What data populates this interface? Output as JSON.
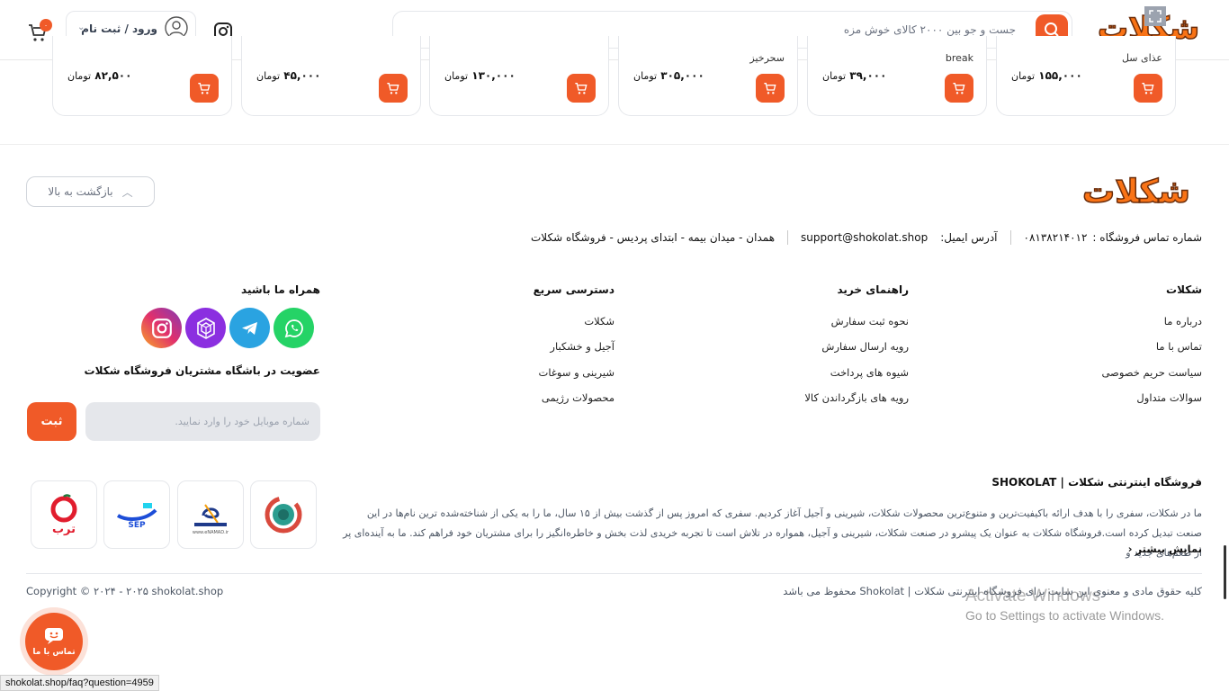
{
  "header": {
    "logo_text": "شکلات",
    "search_placeholder": "جست و جو بین ۲۰۰۰ کالای خوش مزه",
    "login_label": "ورود / ثبت نام",
    "cart_count": "۰"
  },
  "products": [
    {
      "name": "عذای سل",
      "price": "۱۵۵,۰۰۰",
      "unit": "تومان"
    },
    {
      "name": "break",
      "price": "۳۹,۰۰۰",
      "unit": "تومان"
    },
    {
      "name": "سحرخیز",
      "price": "۳۰۵,۰۰۰",
      "unit": "تومان"
    },
    {
      "name": "",
      "price": "۱۳۰,۰۰۰",
      "unit": "تومان"
    },
    {
      "name": "",
      "price": "۴۵,۰۰۰",
      "unit": "تومان"
    },
    {
      "name": "",
      "price": "۸۲,۵۰۰",
      "unit": "تومان"
    }
  ],
  "footer": {
    "logo_text": "شکلات",
    "back_to_top": "بازگشت به بالا",
    "contact": {
      "phone_label": "شماره تماس فروشگاه :",
      "phone": "۰۸۱۳۸۲۱۴۰۱۲",
      "email_label": "آدرس ایمیل:",
      "email": "support@shokolat.shop",
      "address": "همدان - میدان بیمه - ابتدای پردیس - فروشگاه شکلات"
    },
    "columns": [
      {
        "title": "شکلات",
        "links": [
          "درباره ما",
          "تماس با ما",
          "سیاست حریم خصوصی",
          "سوالات متداول"
        ]
      },
      {
        "title": "راهنمای خرید",
        "links": [
          "نحوه ثبت سفارش",
          "رویه ارسال سفارش",
          "شیوه های پرداخت",
          "رویه های بازگرداندن کالا"
        ]
      },
      {
        "title": "دسترسی سریع",
        "links": [
          "شکلات",
          "آجیل و خشکبار",
          "شیرینی و سوغات",
          "محصولات رژیمی"
        ]
      }
    ],
    "social_title": "همراه ما باشید",
    "club_title": "عضویت در باشگاه مشتریان فروشگاه شکلات",
    "mobile_placeholder": "شماره موبایل خود را وارد نمایید.",
    "submit_label": "ثبت",
    "about_title": "فروشگاه اینترنتی شکلات | SHOKOLAT",
    "about_text": "ما در شکلات، سفری را با هدف ارائه باکیفیت‌ترین و متنوع‌ترین محصولات شکلات، شیرینی و آجیل آغاز کردیم. سفری که امروز پس از گذشت بیش از ۱۵ سال، ما را به یکی از شناخته‌شده ترین نام‌ها در این صنعت تبدیل کرده است.فروشگاه شکلات به عنوان یک پیشرو در صنعت شکلات، شیرینی و آجیل، همواره در تلاش است تا تجربه خریدی لذت بخش و خاطره‌انگیز را برای مشتریان خود فراهم کند. ما به آینده‌ای پر از طعم‌های جدید و",
    "more_label": "نمایش بیشتر",
    "trust_badges": [
      "torob",
      "sep",
      "enamad",
      "samandehi"
    ],
    "torob_text": "ترب",
    "sep_text": "SEP",
    "copyright": "Copyright © ۲۰۲۴ - ۲۰۲۵ shokolat.shop",
    "rights": "کلیه حقوق مادی و معنوی این سایت برای فروشگاه اینترنتی شکلات | Shokolat محفوظ می باشد"
  },
  "contact_fab": "تماس با ما",
  "status_url": "shokolat.shop/faq?question=4959",
  "watermark": {
    "title": "Activate Windows",
    "subtitle": "Go to Settings to activate Windows."
  },
  "colors": {
    "accent": "#f05a28",
    "logo_orange": "#f97316"
  }
}
